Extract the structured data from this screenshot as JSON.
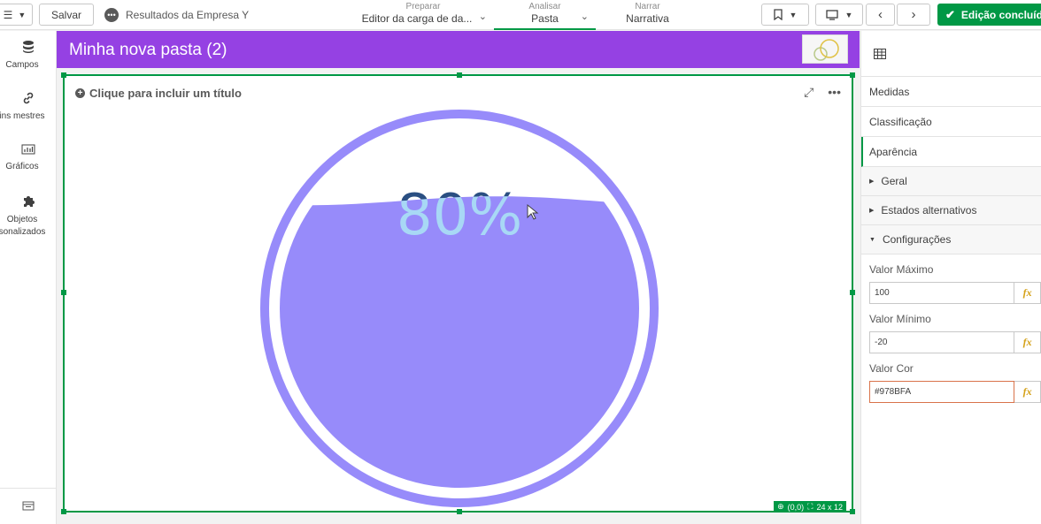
{
  "toolbar": {
    "save_label": "Salvar",
    "app_name": "Resultados da Empresa Y",
    "done_label": "Edição concluída"
  },
  "nav_tabs": [
    {
      "sub": "Preparar",
      "main": "Editor da carga de da..."
    },
    {
      "sub": "Analisar",
      "main": "Pasta"
    },
    {
      "sub": "Narrar",
      "main": "Narrativa"
    }
  ],
  "left_nav": [
    {
      "label": "Campos",
      "icon": "database-icon"
    },
    {
      "label": "ins mestres",
      "icon": "link-icon"
    },
    {
      "label": "Gráficos",
      "icon": "chart-icon"
    },
    {
      "label": "Objetos",
      "label2": "sonalizados",
      "icon": "puzzle-icon"
    }
  ],
  "sheet": {
    "title": "Minha nova pasta (2)"
  },
  "object": {
    "title_placeholder": "Clique para incluir um título",
    "gauge_value": "80%",
    "fill_fraction": 0.8,
    "gauge_color": "#978BFA",
    "position_badge": "(0,0)",
    "size_badge": "24 x 12"
  },
  "right_panel": {
    "tabs": [
      "Medidas",
      "Classificação",
      "Aparência"
    ],
    "sections": [
      "Geral",
      "Estados alternativos",
      "Configurações"
    ],
    "fields": [
      {
        "label": "Valor Máximo",
        "value": "100"
      },
      {
        "label": "Valor Mínimo",
        "value": "-20"
      },
      {
        "label": "Valor Cor",
        "value": "#978BFA"
      }
    ],
    "fx_label": "fx"
  }
}
